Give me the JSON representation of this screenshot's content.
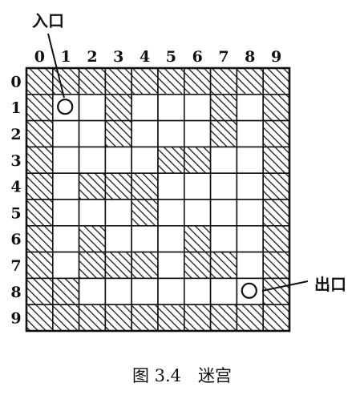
{
  "labels": {
    "entrance": "入口",
    "exit": "出口",
    "caption": "图 3.4　迷宫"
  },
  "columns": [
    "0",
    "1",
    "2",
    "3",
    "4",
    "5",
    "6",
    "7",
    "8",
    "9"
  ],
  "rows": [
    "0",
    "1",
    "2",
    "3",
    "4",
    "5",
    "6",
    "7",
    "8",
    "9"
  ],
  "maze": [
    [
      1,
      1,
      1,
      1,
      1,
      1,
      1,
      1,
      1,
      1
    ],
    [
      1,
      0,
      0,
      1,
      0,
      0,
      0,
      1,
      0,
      1
    ],
    [
      1,
      0,
      0,
      1,
      0,
      0,
      0,
      1,
      0,
      1
    ],
    [
      1,
      0,
      0,
      0,
      0,
      1,
      1,
      0,
      0,
      1
    ],
    [
      1,
      0,
      1,
      1,
      1,
      0,
      0,
      0,
      0,
      1
    ],
    [
      1,
      0,
      0,
      0,
      1,
      0,
      0,
      0,
      0,
      1
    ],
    [
      1,
      0,
      1,
      0,
      0,
      0,
      1,
      0,
      0,
      1
    ],
    [
      1,
      0,
      1,
      1,
      1,
      0,
      1,
      1,
      0,
      1
    ],
    [
      1,
      1,
      0,
      0,
      0,
      0,
      0,
      0,
      0,
      1
    ],
    [
      1,
      1,
      1,
      1,
      1,
      1,
      1,
      1,
      1,
      1
    ]
  ],
  "entrance_cell": {
    "row": 1,
    "col": 1
  },
  "exit_cell": {
    "row": 8,
    "col": 8
  },
  "legend": {
    "1": "wall (hatched)",
    "0": "open path"
  }
}
